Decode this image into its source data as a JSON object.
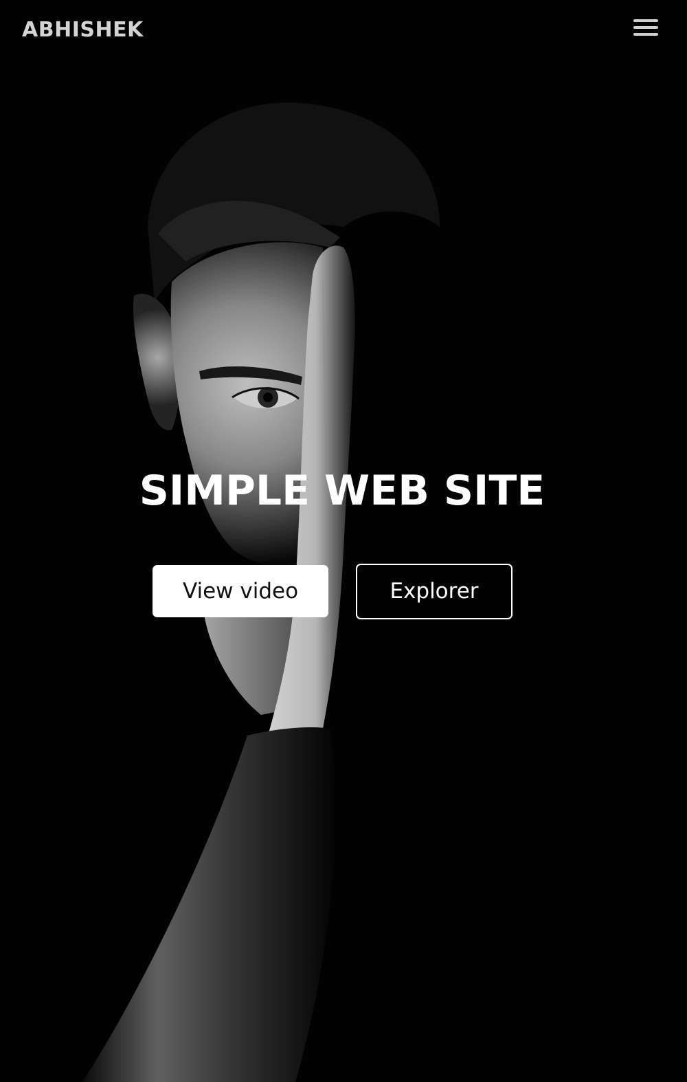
{
  "header": {
    "brand": "ABHISHEK",
    "menu_icon": "hamburger-menu-icon"
  },
  "hero": {
    "image": "black-and-white-portrait-hand-over-face",
    "title": "SIMPLE WEB SITE",
    "buttons": [
      {
        "label": "View video",
        "style": "filled"
      },
      {
        "label": "Explorer",
        "style": "outline"
      }
    ]
  },
  "colors": {
    "background": "#000000",
    "brand_text": "#d4d4d4",
    "primary_button_bg": "#ffffff",
    "primary_button_text": "#111111",
    "outline_button_border": "#ffffff",
    "title_text": "#ffffff"
  }
}
